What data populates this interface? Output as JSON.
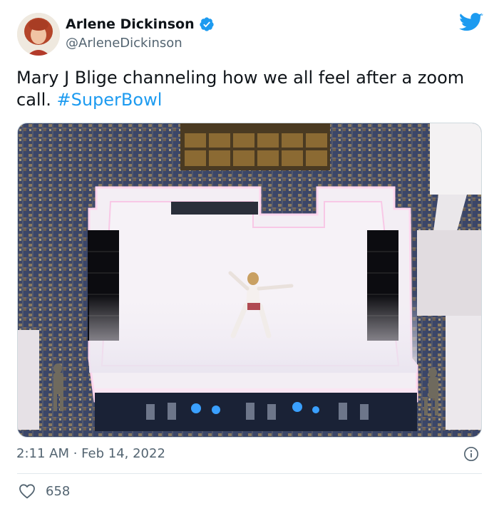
{
  "author": {
    "display_name": "Arlene Dickinson",
    "handle": "@ArleneDickinson",
    "verified": true
  },
  "tweet": {
    "text": "Mary J Blige channeling how we all feel after a zoom call. ",
    "hashtag": "#SuperBowl"
  },
  "meta": {
    "timestamp": "2:11 AM · Feb 14, 2022"
  },
  "engagement": {
    "likes": "658"
  },
  "colors": {
    "accent": "#1d9bf0",
    "secondary_text": "#536471"
  },
  "icons": [
    "verified-badge-icon",
    "twitter-bird-icon",
    "info-icon",
    "heart-icon"
  ]
}
